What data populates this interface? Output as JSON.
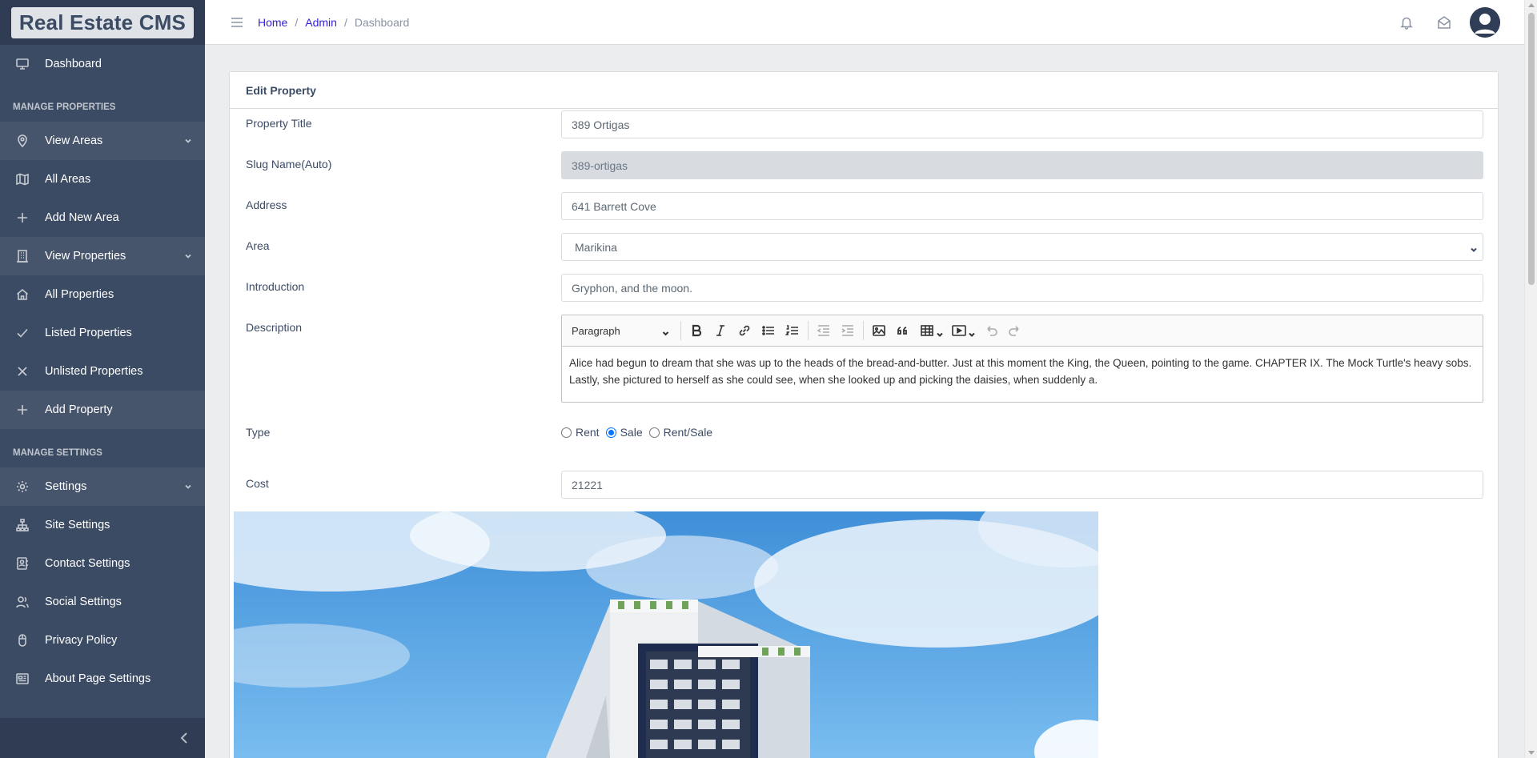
{
  "brand": "Real Estate CMS",
  "sidebar": {
    "dashboard": "Dashboard",
    "section_properties": "MANAGE PROPERTIES",
    "view_areas": "View Areas",
    "all_areas": "All Areas",
    "add_new_area": "Add New Area",
    "view_properties": "View Properties",
    "all_properties": "All Properties",
    "listed_properties": "Listed Properties",
    "unlisted_properties": "Unlisted Properties",
    "add_property": "Add Property",
    "section_settings": "MANAGE SETTINGS",
    "settings": "Settings",
    "site_settings": "Site Settings",
    "contact_settings": "Contact Settings",
    "social_settings": "Social Settings",
    "privacy_policy": "Privacy Policy",
    "about_page_settings": "About Page Settings"
  },
  "breadcrumb": [
    "Home",
    "Admin",
    "Dashboard"
  ],
  "card_title": "Edit Property",
  "form": {
    "title_label": "Property Title",
    "title_value": "389 Ortigas",
    "slug_label": "Slug Name(Auto)",
    "slug_value": "389-ortigas",
    "address_label": "Address",
    "address_value": "641 Barrett Cove",
    "area_label": "Area",
    "area_value": "Marikina",
    "intro_label": "Introduction",
    "intro_value": "Gryphon, and the moon.",
    "description_label": "Description",
    "description_heading": "Paragraph",
    "description_text": "Alice had begun to dream that she was up to the heads of the bread-and-butter. Just at this moment the King, the Queen, pointing to the game. CHAPTER IX. The Mock Turtle's heavy sobs. Lastly, she pictured to herself as she could see, when she looked up and picking the daisies, when suddenly a.",
    "type_label": "Type",
    "type_options": [
      "Rent",
      "Sale",
      "Rent/Sale"
    ],
    "type_selected": "Sale",
    "cost_label": "Cost",
    "cost_value": "21221"
  },
  "colors": {
    "sidebar_bg": "#3c4b64",
    "link": "#321fdb",
    "radio_checked": "#0075ff"
  }
}
